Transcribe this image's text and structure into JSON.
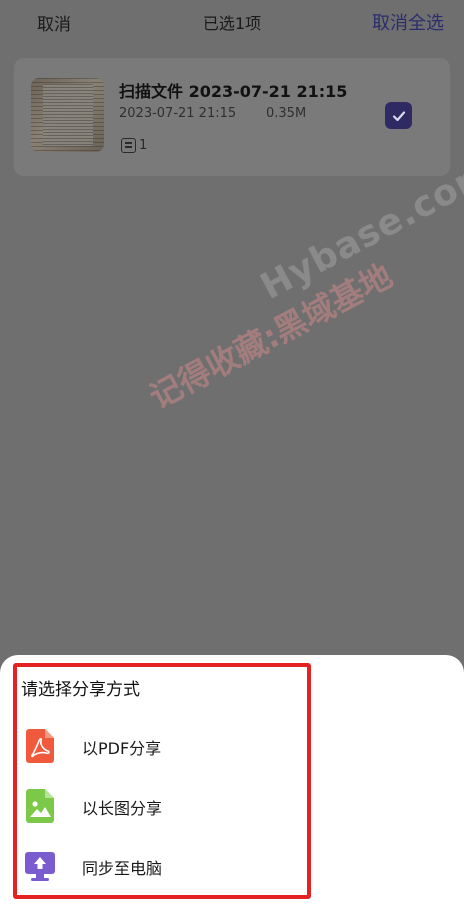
{
  "topbar": {
    "cancel": "取消",
    "title": "已选1项",
    "deselect_all": "取消全选"
  },
  "file": {
    "name": "扫描文件 2023-07-21 21:15",
    "date": "2023-07-21 21:15",
    "size": "0.35M",
    "page_count": "1",
    "selected": true
  },
  "watermark": {
    "chinese": "记得收藏:黑域基地",
    "latin": "Hybase.com"
  },
  "share_sheet": {
    "title": "请选择分享方式",
    "options": [
      {
        "label": "以PDF分享",
        "icon": "pdf-icon",
        "color": "#f05a3c"
      },
      {
        "label": "以长图分享",
        "icon": "image-icon",
        "color": "#7cc94a"
      },
      {
        "label": "同步至电脑",
        "icon": "computer-sync-icon",
        "color": "#7a5ccf"
      }
    ]
  },
  "colors": {
    "accent": "#2f2a63",
    "highlight_border": "#e32222"
  }
}
